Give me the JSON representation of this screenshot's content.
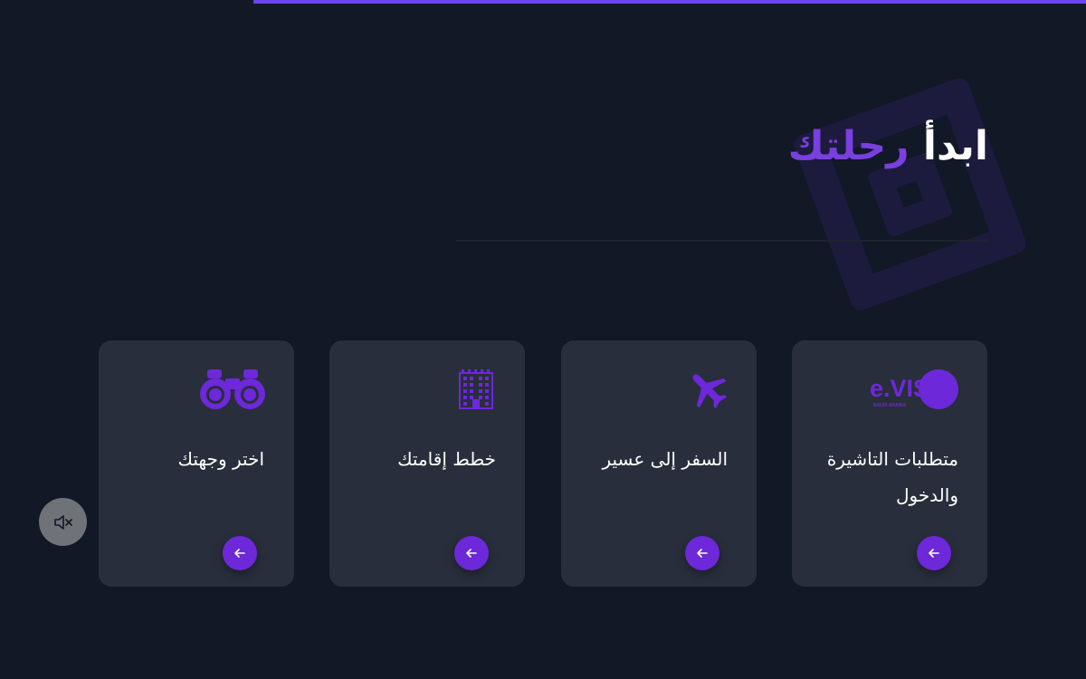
{
  "progress": {
    "fraction": 0.767
  },
  "heading": {
    "word1": "ابدأ",
    "word2": "رحلتك"
  },
  "colors": {
    "accent": "#7a3fe0",
    "button": "#6d28d9",
    "background": "#111826",
    "card": "#282e3b"
  },
  "cards": [
    {
      "title": "متطلبات التاشيرة والدخول",
      "icon": "evisa-logo-icon",
      "logo_text": "e.VISA",
      "logo_subtext": "SAUDI ARABIA"
    },
    {
      "title": "السفر إلى عسير",
      "icon": "airplane-icon"
    },
    {
      "title": "خطط إقامتك",
      "icon": "building-icon"
    },
    {
      "title": "اختر وجهتك",
      "icon": "binoculars-icon"
    }
  ],
  "controls": {
    "mute_icon": "speaker-muted-icon",
    "arrow_icon": "arrow-left-icon"
  }
}
